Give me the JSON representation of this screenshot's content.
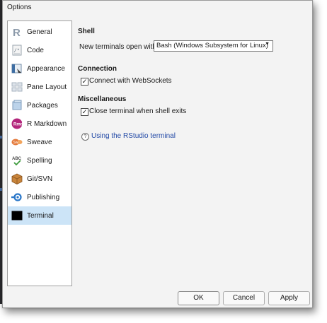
{
  "window": {
    "title": "Options"
  },
  "sidebar": {
    "items": [
      {
        "label": "General",
        "icon": "r-logo-icon",
        "selected": false
      },
      {
        "label": "Code",
        "icon": "code-icon",
        "selected": false
      },
      {
        "label": "Appearance",
        "icon": "appearance-icon",
        "selected": false
      },
      {
        "label": "Pane Layout",
        "icon": "pane-layout-icon",
        "selected": false
      },
      {
        "label": "Packages",
        "icon": "packages-icon",
        "selected": false
      },
      {
        "label": "R Markdown",
        "icon": "rmarkdown-icon",
        "selected": false
      },
      {
        "label": "Sweave",
        "icon": "sweave-icon",
        "selected": false
      },
      {
        "label": "Spelling",
        "icon": "spelling-icon",
        "selected": false
      },
      {
        "label": "Git/SVN",
        "icon": "git-svn-icon",
        "selected": false
      },
      {
        "label": "Publishing",
        "icon": "publishing-icon",
        "selected": false
      },
      {
        "label": "Terminal",
        "icon": "terminal-icon",
        "selected": true
      }
    ],
    "selected_color": "#cce4f7"
  },
  "shell": {
    "title": "Shell",
    "new_terminals_label": "New terminals open with:",
    "new_terminals_value": "Bash (Windows Subsystem for Linux)"
  },
  "connection": {
    "title": "Connection",
    "websockets_label": "Connect with WebSockets",
    "websockets_checked": true,
    "check_mark": "✓"
  },
  "misc": {
    "title": "Miscellaneous",
    "close_terminal_label": "Close terminal when shell exits",
    "close_terminal_checked": true,
    "check_mark": "✓"
  },
  "help": {
    "link_text": "Using the RStudio terminal",
    "icon_glyph": "?"
  },
  "buttons": {
    "ok": "OK",
    "cancel": "Cancel",
    "apply": "Apply"
  },
  "colors": {
    "link": "#2249a6",
    "selection": "#cce4f7"
  }
}
